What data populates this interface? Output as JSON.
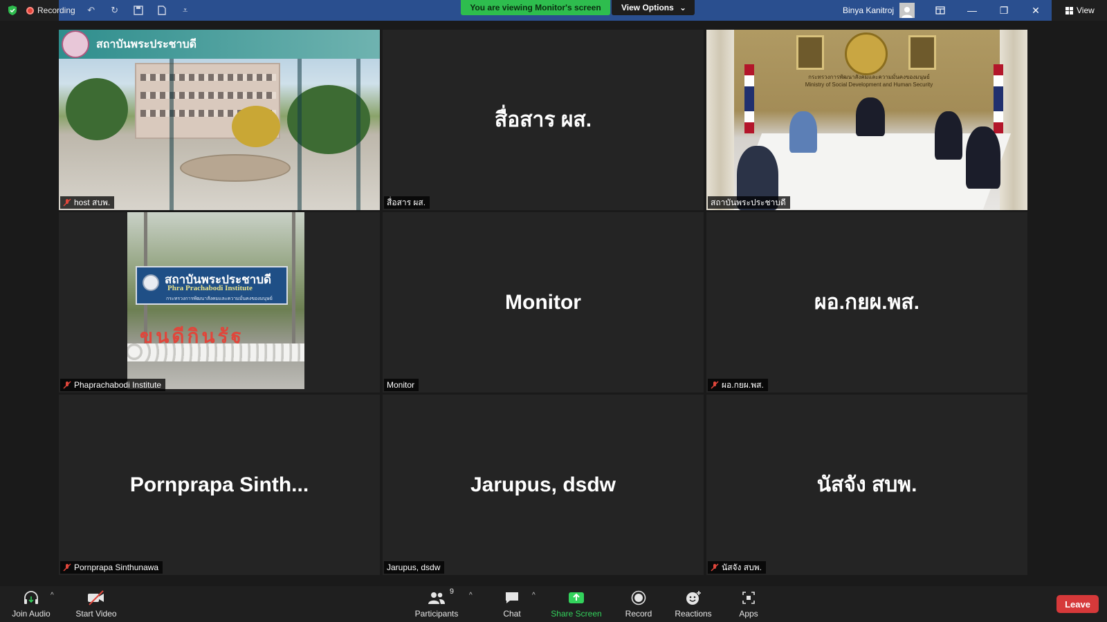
{
  "titlebar": {
    "recording_label": "Recording",
    "viewing_banner": "You are viewing Monitor's screen",
    "view_options_label": "View Options",
    "user_name": "Binya Kanitroj",
    "view_label": "View"
  },
  "tiles": [
    {
      "name": "host สบพ.",
      "banner_text": "สถาบันพระประชาบดี"
    },
    {
      "name": "สื่อสาร ผส.",
      "center_name": "สื่อสาร ผส."
    },
    {
      "name": "สถาบันพระประชาบดี",
      "ministry_th": "กระทรวงการพัฒนาสังคมและความมั่นคงของมนุษย์",
      "ministry_en": "Ministry of Social Development and Human Security"
    },
    {
      "name": "Phaprachabodi Institute",
      "sign_th": "สถาบันพระประชาบดี",
      "sign_en": "Phra Prachabodi Institute",
      "sign_sub": "กระทรวงการพัฒนาสังคมและความมั่นคงของมนุษย์",
      "sign_letters": "ขนดีกินรัฐ"
    },
    {
      "name": "Monitor",
      "center_name": "Monitor"
    },
    {
      "name": "ผอ.กยผ.พส.",
      "center_name": "ผอ.กยผ.พส."
    },
    {
      "name": "Pornprapa Sinthunawa",
      "center_name": "Pornprapa  Sinth..."
    },
    {
      "name": "Jarupus, dsdw",
      "center_name": "Jarupus, dsdw"
    },
    {
      "name": "นัสจัง สบพ.",
      "center_name": "นัสจัง สบพ."
    }
  ],
  "toolbar": {
    "join_audio": "Join Audio",
    "start_video": "Start Video",
    "participants": "Participants",
    "participants_count": "9",
    "chat": "Chat",
    "share_screen": "Share Screen",
    "record": "Record",
    "reactions": "Reactions",
    "apps": "Apps",
    "leave": "Leave"
  },
  "colors": {
    "titlebar_blue": "#2a4f8f",
    "banner_green": "#2ebd4e",
    "active_speaker": "#f2e96b",
    "leave_red": "#d6393a",
    "share_green": "#33d35c"
  }
}
